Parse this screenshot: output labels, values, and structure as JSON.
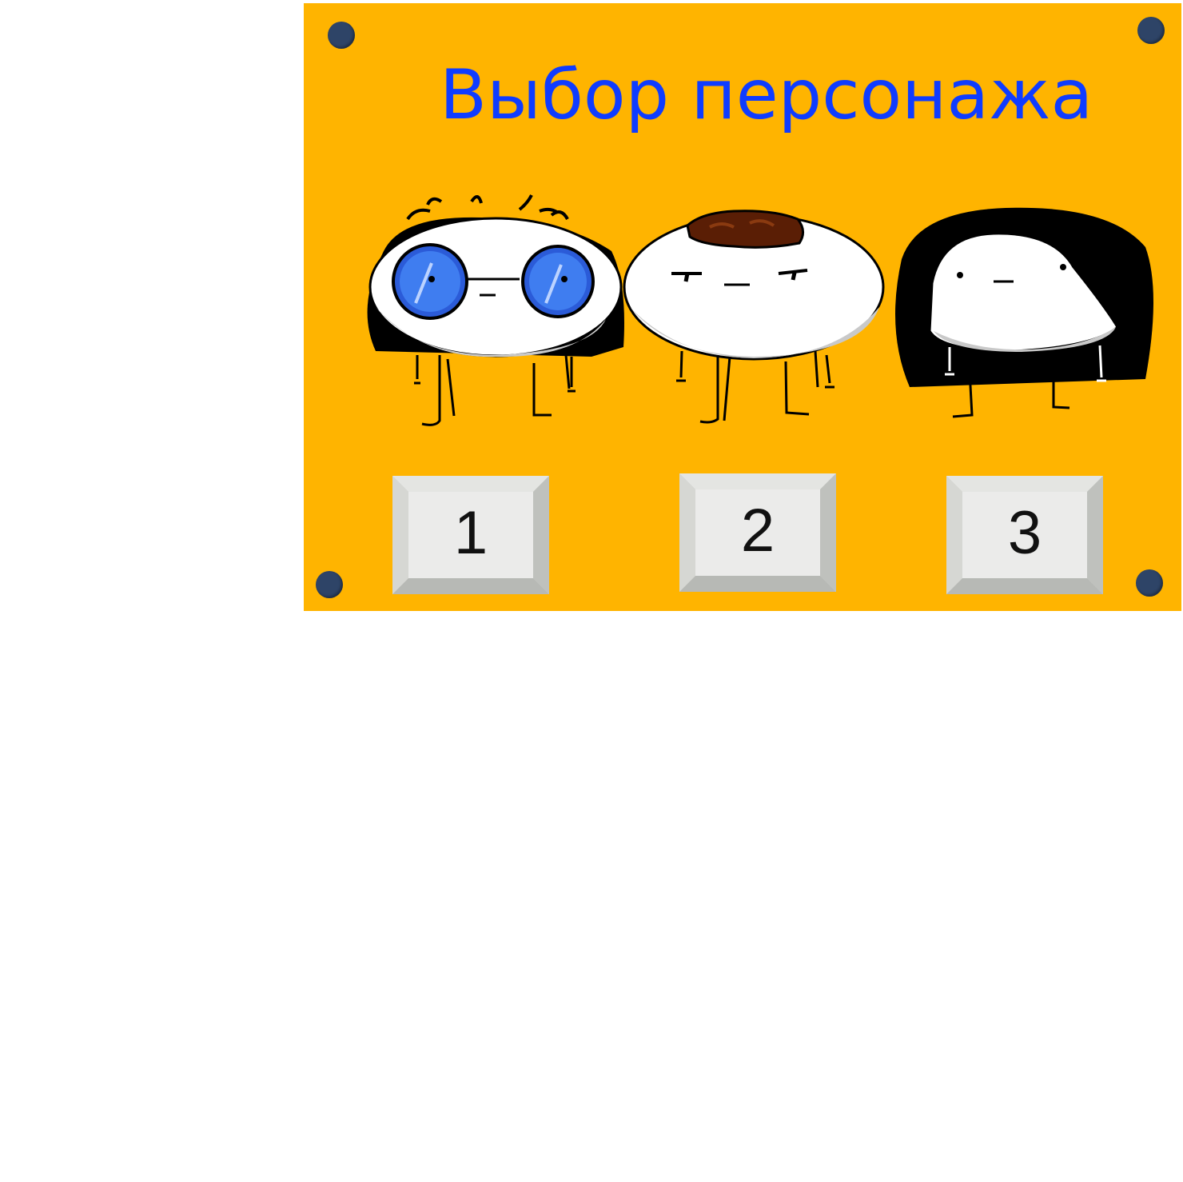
{
  "screen": {
    "title": "Выбор персонажа",
    "background_color": "#ffb400",
    "title_color": "#0f3cff",
    "screw_color": "#2e4467"
  },
  "characters": [
    {
      "name": "character-glasses",
      "icon": "character-with-blue-glasses"
    },
    {
      "name": "character-brown-hair",
      "icon": "character-with-brown-hair"
    },
    {
      "name": "character-black-hood",
      "icon": "character-in-black-hood"
    }
  ],
  "keys": [
    {
      "label": "1"
    },
    {
      "label": "2"
    },
    {
      "label": "3"
    }
  ]
}
